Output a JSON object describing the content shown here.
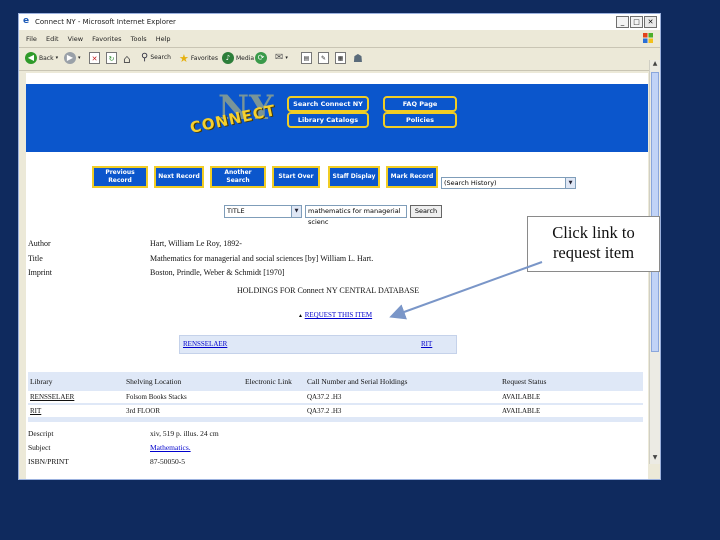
{
  "window": {
    "title": "Connect NY - Microsoft Internet Explorer",
    "controls": {
      "minimize": "_",
      "maximize": "□",
      "close": "✕"
    }
  },
  "menubar": [
    "File",
    "Edit",
    "View",
    "Favorites",
    "Tools",
    "Help"
  ],
  "toolbar": {
    "back": "Back",
    "search": "Search",
    "favorites": "Favorites",
    "media": "Media"
  },
  "banner": {
    "logo_text": "CONNECT",
    "logo_ny": "NY",
    "buttons": [
      "Search Connect NY",
      "FAQ Page",
      "Library Catalogs",
      "Policies"
    ]
  },
  "nav": {
    "previous": "Previous Record",
    "next": "Next Record",
    "another": "Another Search",
    "start_over": "Start Over",
    "staff": "Staff Display",
    "mark": "Mark Record",
    "history_select": "(Search History)"
  },
  "search": {
    "field": "TITLE",
    "query": "mathematics for managerial scienc",
    "button": "Search"
  },
  "record": {
    "author_label": "Author",
    "author": "Hart, William Le Roy, 1892-",
    "title_label": "Title",
    "title": "Mathematics for managerial and social sciences [by] William L. Hart.",
    "imprint_label": "Imprint",
    "imprint": "Boston, Prindle, Weber & Schmidt [1970]"
  },
  "holdings": {
    "title": "HOLDINGS FOR Connect NY CENTRAL DATABASE",
    "request_link": "REQUEST THIS ITEM",
    "libraries": [
      "RENSSELAER",
      "RIT"
    ]
  },
  "table": {
    "headers": [
      "Library",
      "Shelving Location",
      "Electronic Link",
      "Call Number and Serial Holdings",
      "Request Status"
    ],
    "rows": [
      [
        "RENSSELAER",
        "Folsom Books Stacks",
        "",
        "QA37.2 .H3",
        "AVAILABLE"
      ],
      [
        "RIT",
        "3rd FLOOR",
        "",
        "QA37.2 .H3",
        "AVAILABLE"
      ]
    ]
  },
  "footer": {
    "descript_label": "Descript",
    "descript": "xiv, 519 p. illus. 24 cm",
    "subject_label": "Subject",
    "subject": "Mathematics.",
    "isbn_label": "ISBN/PRINT",
    "isbn": "87-50050-5"
  },
  "callout": {
    "text": "Click link to request item"
  },
  "colors": {
    "background": "#0f2a5e",
    "banner": "#0b56cc",
    "gold": "#f1cd24",
    "table_bg": "#dfe8f7"
  }
}
